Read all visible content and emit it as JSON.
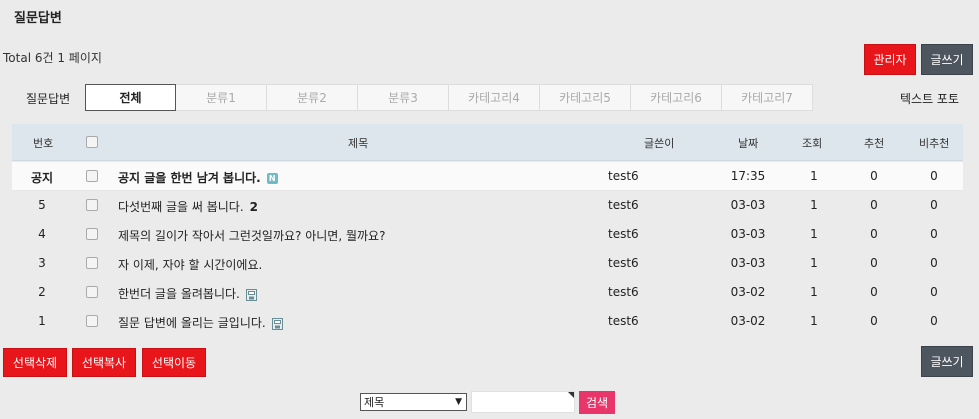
{
  "page": {
    "title": "질문답변",
    "total": "Total 6건 1 페이지"
  },
  "buttons": {
    "admin": "관리자",
    "write": "글쓰기",
    "delete_selected": "선택삭제",
    "copy_selected": "선택복사",
    "move_selected": "선택이동"
  },
  "categories": {
    "label": "질문답변",
    "tabs": [
      "전체",
      "분류1",
      "분류2",
      "분류3",
      "카테고리4",
      "카테고리5",
      "카테고리6",
      "카테고리7"
    ],
    "text_post": "텍스트 포토"
  },
  "table": {
    "headers": {
      "no": "번호",
      "subject": "제목",
      "writer": "글쓴이",
      "date": "날짜",
      "views": "조회",
      "recommend": "추천",
      "not_recommend": "비추천"
    },
    "rows": [
      {
        "no": "공지",
        "subject": "공지 글을 한번 남겨 봅니다.",
        "comments": "",
        "icon": "new-icon",
        "writer": "test6",
        "date": "17:35",
        "views": "1",
        "recommend": "0",
        "not_recommend": "0"
      },
      {
        "no": "5",
        "subject": "다섯번째 글을 써 봅니다.",
        "comments": "2",
        "icon": "",
        "writer": "test6",
        "date": "03-03",
        "views": "1",
        "recommend": "0",
        "not_recommend": "0"
      },
      {
        "no": "4",
        "subject": "제목의 길이가 작아서 그런것일까요? 아니면, 뭘까요?",
        "comments": "",
        "icon": "",
        "writer": "test6",
        "date": "03-03",
        "views": "1",
        "recommend": "0",
        "not_recommend": "0"
      },
      {
        "no": "3",
        "subject": "자 이제, 자야 할 시간이에요.",
        "comments": "",
        "icon": "",
        "writer": "test6",
        "date": "03-03",
        "views": "1",
        "recommend": "0",
        "not_recommend": "0"
      },
      {
        "no": "2",
        "subject": "한번더 글을 올려봅니다.",
        "comments": "",
        "icon": "file-icon",
        "writer": "test6",
        "date": "03-02",
        "views": "1",
        "recommend": "0",
        "not_recommend": "0"
      },
      {
        "no": "1",
        "subject": "질문 답변에 올리는 글입니다.",
        "comments": "",
        "icon": "file-icon",
        "writer": "test6",
        "date": "03-02",
        "views": "1",
        "recommend": "0",
        "not_recommend": "0"
      }
    ]
  },
  "search": {
    "field_selected": "제목",
    "button": "검색"
  },
  "colors": {
    "red": "#e8161b",
    "dark": "#4d555e",
    "pink": "#e8356a",
    "header_bg": "#dde6ec"
  }
}
